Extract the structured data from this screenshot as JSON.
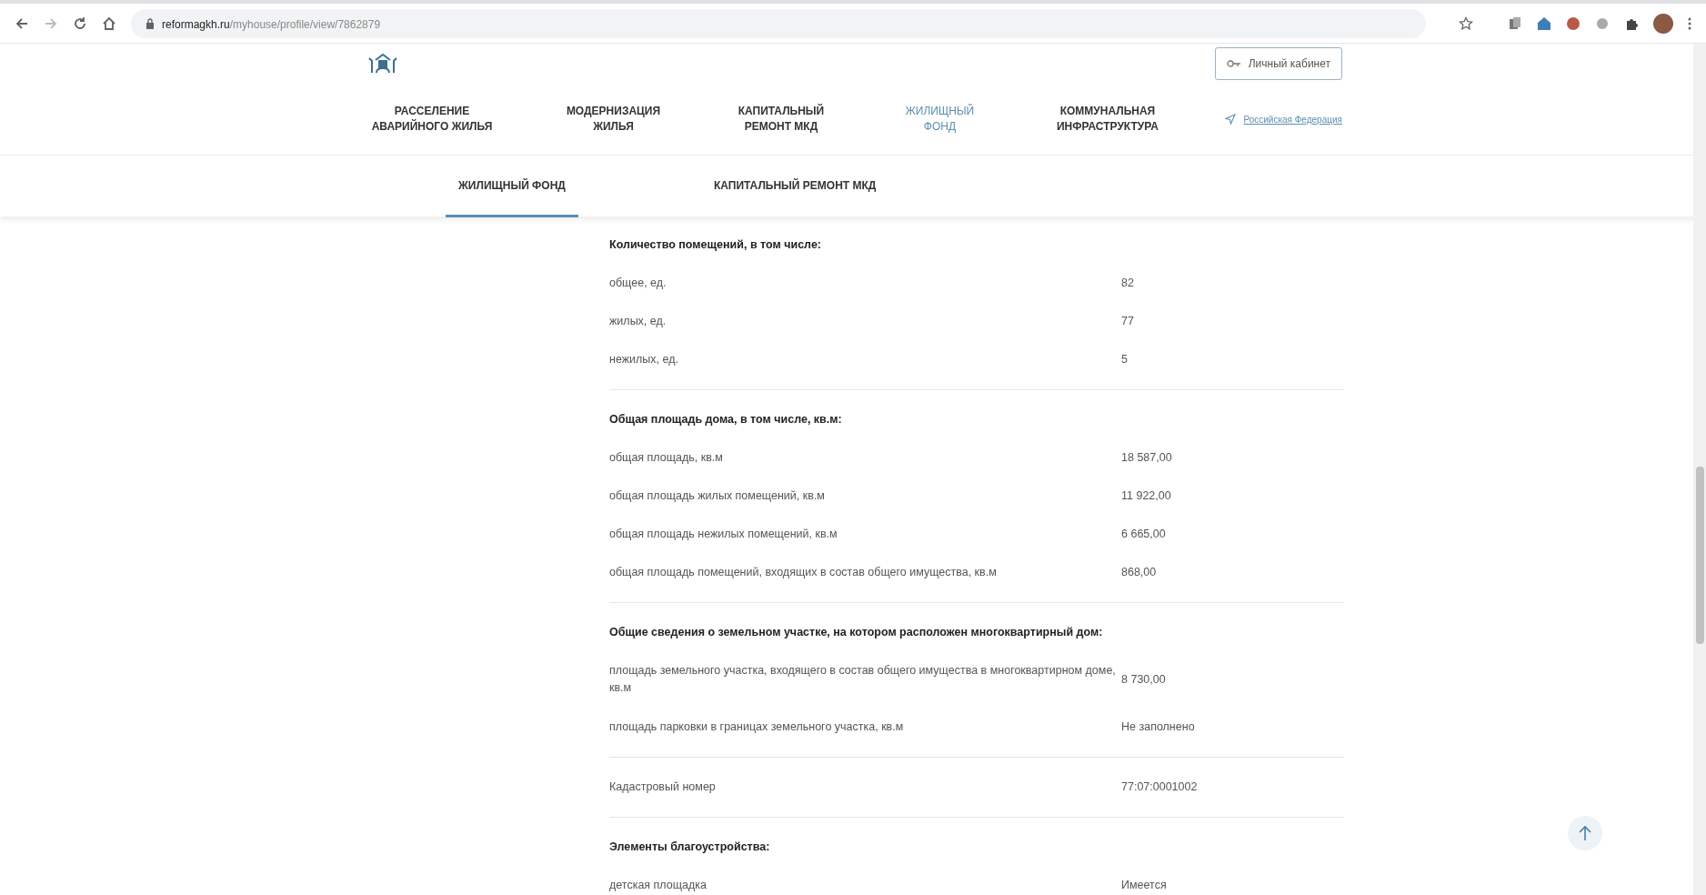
{
  "browser": {
    "url_host": "reformagkh.ru",
    "url_path": "/myhouse/profile/view/7862879"
  },
  "header": {
    "login_label": "Личный кабинет",
    "nav": [
      {
        "label": "РАССЕЛЕНИЕ АВАРИЙНОГО ЖИЛЬЯ",
        "selected": false
      },
      {
        "label": "МОДЕРНИЗАЦИЯ ЖИЛЬЯ",
        "selected": false
      },
      {
        "label": "КАПИТАЛЬНЫЙ РЕМОНТ МКД",
        "selected": false
      },
      {
        "label": "ЖИЛИЩНЫЙ ФОНД",
        "selected": true
      },
      {
        "label": "КОММУНАЛЬНАЯ ИНФРАСТРУКТУРА",
        "selected": false
      }
    ],
    "region_link": "Российская Федерация"
  },
  "subtabs": [
    {
      "label": "ЖИЛИЩНЫЙ ФОНД",
      "selected": true
    },
    {
      "label": "КАПИТАЛЬНЫЙ РЕМОНТ МКД",
      "selected": false
    }
  ],
  "sections": [
    {
      "heading": "Количество помещений, в том числе:",
      "rows": [
        {
          "label": "общее, ед.",
          "value": "82"
        },
        {
          "label": "жилых, ед.",
          "value": "77"
        },
        {
          "label": "нежилых, ед.",
          "value": "5"
        }
      ]
    },
    {
      "heading": "Общая площадь дома, в том числе, кв.м:",
      "rows": [
        {
          "label": "общая площадь, кв.м",
          "value": "18 587,00"
        },
        {
          "label": "общая площадь жилых помещений, кв.м",
          "value": "11 922,00"
        },
        {
          "label": "общая площадь нежилых помещений, кв.м",
          "value": "6 665,00"
        },
        {
          "label": "общая площадь помещений, входящих в состав общего имущества, кв.м",
          "value": "868,00"
        }
      ]
    },
    {
      "heading": "Общие сведения о земельном участке, на котором расположен многоквартирный дом:",
      "rows": [
        {
          "label": "площадь земельного участка, входящего в состав общего имущества в многоквартирном доме, кв.м",
          "value": "8 730,00"
        },
        {
          "label": "площадь парковки в границах земельного участка, кв.м",
          "value": "Не заполнено"
        }
      ]
    },
    {
      "rows": [
        {
          "label": "Кадастровый номер",
          "value": "77:07:0001002"
        }
      ]
    },
    {
      "heading": "Элементы благоустройства:",
      "rows": [
        {
          "label": "детская площадка",
          "value": "Имеется"
        }
      ]
    }
  ]
}
